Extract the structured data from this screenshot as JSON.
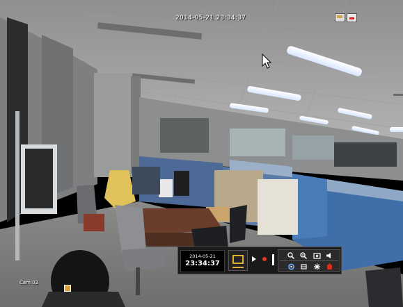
{
  "osd": {
    "timestamp": "2014-05-21 23:34:37",
    "camera_label": "Cam 02"
  },
  "toolbar": {
    "date": "2014-05-21",
    "time": "23:34:37",
    "colors": {
      "split_accent": "#e0b030",
      "record": "#e03a1c"
    },
    "icons": [
      "zoom-in-icon",
      "zoom-out-icon",
      "capture-icon",
      "audio-icon",
      "ptz-icon",
      "freeze-icon",
      "settings-icon",
      "alarm-icon"
    ]
  },
  "status_icons": [
    "hdd-icon",
    "recording-icon"
  ]
}
